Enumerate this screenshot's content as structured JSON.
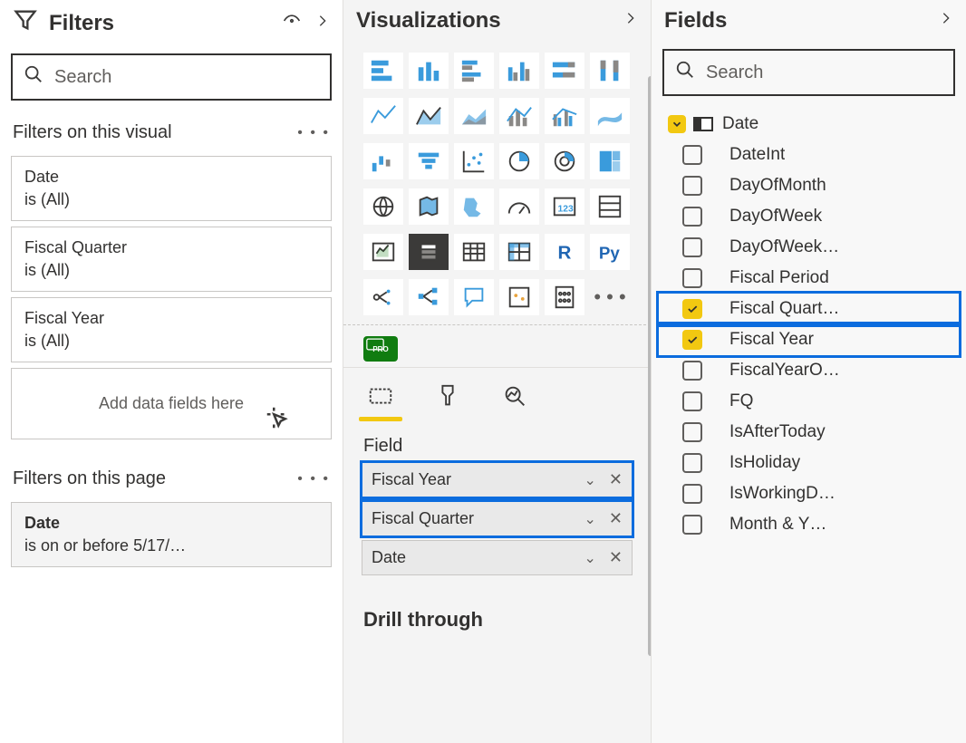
{
  "filters": {
    "title": "Filters",
    "search_placeholder": "Search",
    "visual_section": "Filters on this visual",
    "page_section": "Filters on this page",
    "dropzone": "Add data fields here",
    "cards": [
      {
        "name": "Date",
        "cond": "is (All)"
      },
      {
        "name": "Fiscal Quarter",
        "cond": "is (All)"
      },
      {
        "name": "Fiscal Year",
        "cond": "is (All)"
      }
    ],
    "page_cards": [
      {
        "name": "Date",
        "cond": "is on or before 5/17/…"
      }
    ]
  },
  "viz": {
    "title": "Visualizations",
    "pro": "PRO",
    "field_label": "Field",
    "wells": [
      {
        "name": "Fiscal Year",
        "hilite": true
      },
      {
        "name": "Fiscal Quarter",
        "hilite": true
      },
      {
        "name": "Date",
        "hilite": false
      }
    ],
    "drill": "Drill through"
  },
  "fields": {
    "title": "Fields",
    "search_placeholder": "Search",
    "table_name": "Date",
    "items": [
      {
        "name": "DateInt",
        "checked": false,
        "hilite": false
      },
      {
        "name": "DayOfMonth",
        "checked": false,
        "hilite": false
      },
      {
        "name": "DayOfWeek",
        "checked": false,
        "hilite": false
      },
      {
        "name": "DayOfWeek…",
        "checked": false,
        "hilite": false
      },
      {
        "name": "Fiscal Period",
        "checked": false,
        "hilite": false
      },
      {
        "name": "Fiscal Quart…",
        "checked": true,
        "hilite": true
      },
      {
        "name": "Fiscal Year",
        "checked": true,
        "hilite": true
      },
      {
        "name": "FiscalYearO…",
        "checked": false,
        "hilite": false
      },
      {
        "name": "FQ",
        "checked": false,
        "hilite": false
      },
      {
        "name": "IsAfterToday",
        "checked": false,
        "hilite": false
      },
      {
        "name": "IsHoliday",
        "checked": false,
        "hilite": false
      },
      {
        "name": "IsWorkingD…",
        "checked": false,
        "hilite": false
      },
      {
        "name": "Month & Y…",
        "checked": false,
        "hilite": false
      }
    ]
  }
}
